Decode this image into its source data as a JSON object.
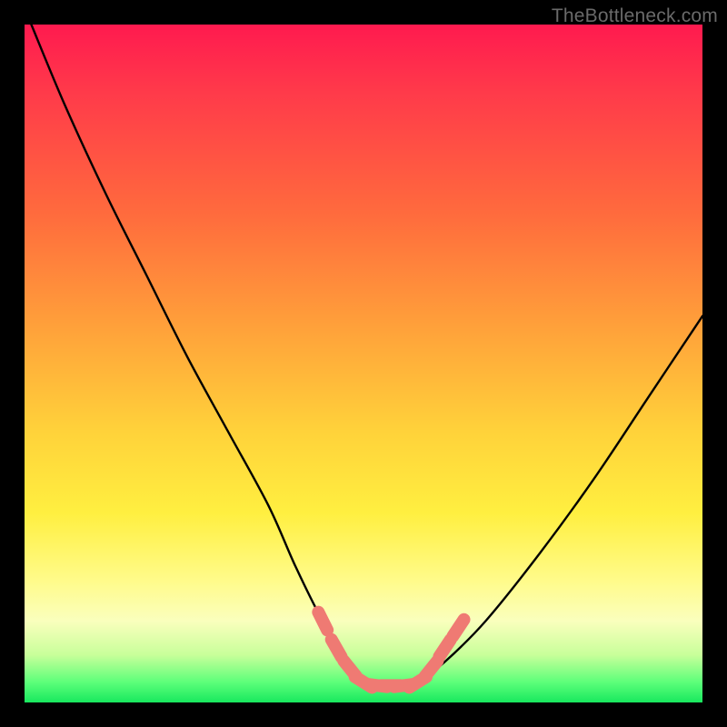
{
  "watermark": "TheBottleneck.com",
  "chart_data": {
    "type": "line",
    "title": "",
    "xlabel": "",
    "ylabel": "",
    "xlim": [
      0,
      100
    ],
    "ylim": [
      0,
      100
    ],
    "series": [
      {
        "name": "bottleneck-curve",
        "x": [
          1,
          6,
          12,
          18,
          24,
          30,
          36,
          40,
          44,
          48,
          50,
          52,
          54,
          56,
          58,
          62,
          68,
          76,
          84,
          92,
          100
        ],
        "y": [
          100,
          88,
          75,
          63,
          51,
          40,
          29,
          20,
          12,
          6,
          3,
          2,
          2,
          2,
          3,
          6,
          12,
          22,
          33,
          45,
          57
        ]
      }
    ],
    "markers": {
      "name": "highlight-beads",
      "points": [
        {
          "x": 44,
          "y": 12
        },
        {
          "x": 46,
          "y": 8
        },
        {
          "x": 48,
          "y": 5
        },
        {
          "x": 50,
          "y": 3
        },
        {
          "x": 52,
          "y": 2.5
        },
        {
          "x": 54,
          "y": 2.5
        },
        {
          "x": 56,
          "y": 2.5
        },
        {
          "x": 58,
          "y": 3
        },
        {
          "x": 60,
          "y": 5
        },
        {
          "x": 62,
          "y": 8
        },
        {
          "x": 64,
          "y": 11
        }
      ],
      "color": "#ef7a73"
    },
    "gradient_stops": [
      {
        "pos": 0.0,
        "color": "#ff1a4f"
      },
      {
        "pos": 0.28,
        "color": "#ff6b3d"
      },
      {
        "pos": 0.6,
        "color": "#ffd23a"
      },
      {
        "pos": 0.82,
        "color": "#fffb8a"
      },
      {
        "pos": 0.93,
        "color": "#c8ff9a"
      },
      {
        "pos": 1.0,
        "color": "#18e85e"
      }
    ]
  }
}
